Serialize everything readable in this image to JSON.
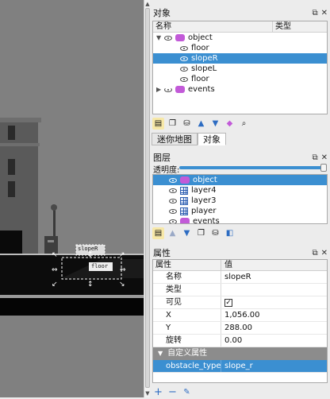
{
  "objects_panel": {
    "title": "对象",
    "col_name": "名称",
    "col_type": "类型",
    "tree": [
      {
        "label": "object",
        "kind": "group",
        "expanded": true,
        "selected": false
      },
      {
        "label": "floor",
        "kind": "object",
        "selected": false
      },
      {
        "label": "slopeR",
        "kind": "object",
        "selected": true
      },
      {
        "label": "slopeL",
        "kind": "object",
        "selected": false
      },
      {
        "label": "floor",
        "kind": "object",
        "selected": false
      },
      {
        "label": "events",
        "kind": "group",
        "expanded": false,
        "selected": false
      }
    ]
  },
  "tabs": [
    "迷你地图",
    "对象"
  ],
  "active_tab": 1,
  "layers_panel": {
    "title": "图层",
    "opacity_label": "透明度:",
    "opacity_fraction": 1.0,
    "layers": [
      {
        "label": "object",
        "kind": "group",
        "selected": true
      },
      {
        "label": "layer4",
        "kind": "tile",
        "selected": false
      },
      {
        "label": "layer3",
        "kind": "tile",
        "selected": false
      },
      {
        "label": "player",
        "kind": "tile",
        "selected": false
      },
      {
        "label": "events",
        "kind": "group",
        "selected": false
      }
    ]
  },
  "properties_panel": {
    "title": "属性",
    "col_prop": "属性",
    "col_value": "值",
    "rows": [
      {
        "key": "名称",
        "value": "slopeR"
      },
      {
        "key": "类型",
        "value": ""
      },
      {
        "key": "可见",
        "value": "✓",
        "checkbox": true
      },
      {
        "key": "X",
        "value": "1,056.00"
      },
      {
        "key": "Y",
        "value": "288.00"
      },
      {
        "key": "旋转",
        "value": "0.00"
      }
    ],
    "custom_section": "自定义属性",
    "custom_rows": [
      {
        "key": "obstacle_type",
        "value": "slope_r"
      }
    ]
  },
  "canvas": {
    "label_slope": "slopeR",
    "label_floor": "floor"
  },
  "colors": {
    "selection": "#3b8fd1",
    "group_icon": "#c25ad8",
    "canvas_bg": "#808080"
  }
}
